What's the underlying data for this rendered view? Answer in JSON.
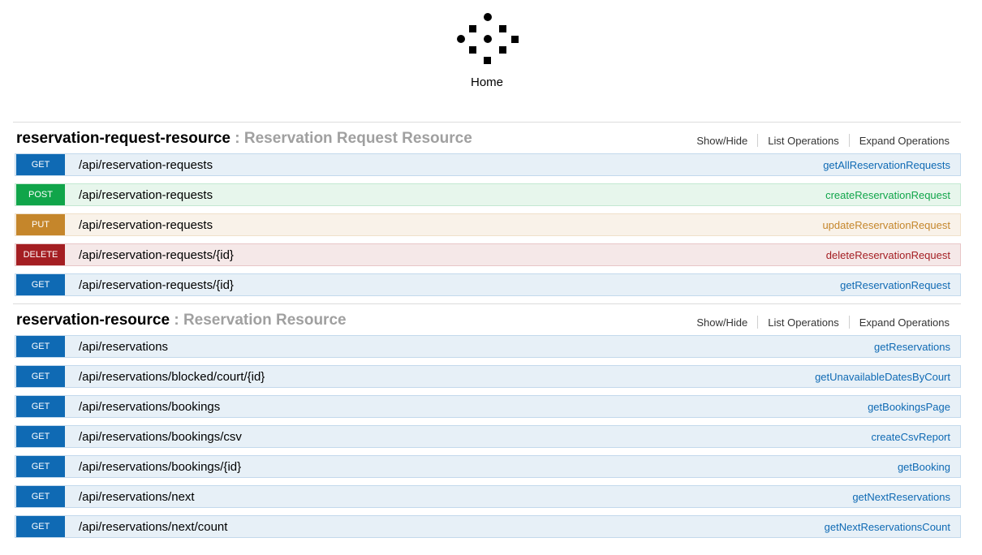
{
  "header": {
    "home_label": "Home",
    "logo_icon": "swagger-dots-logo"
  },
  "colors": {
    "get": "#0f6ab4",
    "post": "#10a54a",
    "put": "#c5862b",
    "delete": "#a41e22"
  },
  "resources": [
    {
      "name": "reservation-request-resource",
      "separator": " : ",
      "description": "Reservation Request Resource",
      "show_hide": "Show/Hide",
      "list_operations": "List Operations",
      "expand_operations": "Expand Operations",
      "endpoints": [
        {
          "method": "GET",
          "path": "/api/reservation-requests",
          "operation": "getAllReservationRequests"
        },
        {
          "method": "POST",
          "path": "/api/reservation-requests",
          "operation": "createReservationRequest"
        },
        {
          "method": "PUT",
          "path": "/api/reservation-requests",
          "operation": "updateReservationRequest"
        },
        {
          "method": "DELETE",
          "path": "/api/reservation-requests/{id}",
          "operation": "deleteReservationRequest"
        },
        {
          "method": "GET",
          "path": "/api/reservation-requests/{id}",
          "operation": "getReservationRequest"
        }
      ]
    },
    {
      "name": "reservation-resource",
      "separator": " : ",
      "description": "Reservation Resource",
      "show_hide": "Show/Hide",
      "list_operations": "List Operations",
      "expand_operations": "Expand Operations",
      "endpoints": [
        {
          "method": "GET",
          "path": "/api/reservations",
          "operation": "getReservations"
        },
        {
          "method": "GET",
          "path": "/api/reservations/blocked/court/{id}",
          "operation": "getUnavailableDatesByCourt"
        },
        {
          "method": "GET",
          "path": "/api/reservations/bookings",
          "operation": "getBookingsPage"
        },
        {
          "method": "GET",
          "path": "/api/reservations/bookings/csv",
          "operation": "createCsvReport"
        },
        {
          "method": "GET",
          "path": "/api/reservations/bookings/{id}",
          "operation": "getBooking"
        },
        {
          "method": "GET",
          "path": "/api/reservations/next",
          "operation": "getNextReservations"
        },
        {
          "method": "GET",
          "path": "/api/reservations/next/count",
          "operation": "getNextReservationsCount"
        }
      ]
    }
  ]
}
